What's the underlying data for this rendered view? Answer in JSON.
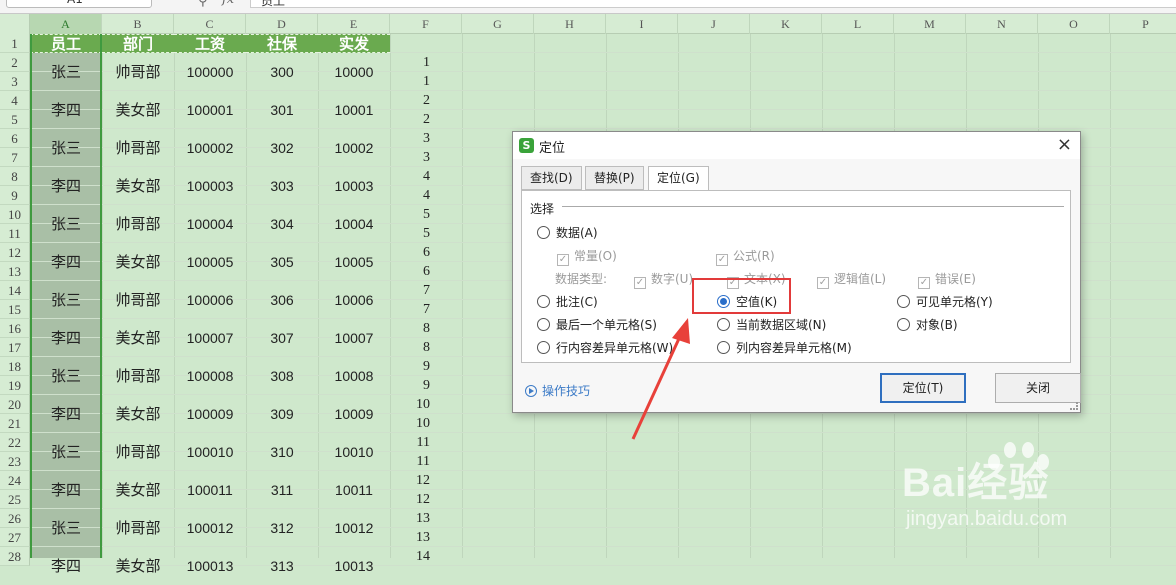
{
  "formula_bar": {
    "cell_ref": "A1",
    "fx_label": "fx",
    "content": "员工"
  },
  "columns": [
    "A",
    "B",
    "C",
    "D",
    "E",
    "F",
    "G",
    "H",
    "I",
    "J",
    "K",
    "L",
    "M",
    "N",
    "O",
    "P"
  ],
  "rows": [
    "1",
    "2",
    "3",
    "4",
    "5",
    "6",
    "7",
    "8",
    "9",
    "10",
    "11",
    "12",
    "13",
    "14",
    "15",
    "16",
    "17",
    "18",
    "19",
    "20",
    "21",
    "22",
    "23",
    "24",
    "25",
    "26",
    "27",
    "28"
  ],
  "table": {
    "headers": [
      "员工",
      "部门",
      "工资",
      "社保",
      "实发"
    ],
    "records": [
      [
        "张三",
        "帅哥部",
        "100000",
        "300",
        "10000"
      ],
      [
        "李四",
        "美女部",
        "100001",
        "301",
        "10001"
      ],
      [
        "张三",
        "帅哥部",
        "100002",
        "302",
        "10002"
      ],
      [
        "李四",
        "美女部",
        "100003",
        "303",
        "10003"
      ],
      [
        "张三",
        "帅哥部",
        "100004",
        "304",
        "10004"
      ],
      [
        "李四",
        "美女部",
        "100005",
        "305",
        "10005"
      ],
      [
        "张三",
        "帅哥部",
        "100006",
        "306",
        "10006"
      ],
      [
        "李四",
        "美女部",
        "100007",
        "307",
        "10007"
      ],
      [
        "张三",
        "帅哥部",
        "100008",
        "308",
        "10008"
      ],
      [
        "李四",
        "美女部",
        "100009",
        "309",
        "10009"
      ],
      [
        "张三",
        "帅哥部",
        "100010",
        "310",
        "10010"
      ],
      [
        "李四",
        "美女部",
        "100011",
        "311",
        "10011"
      ],
      [
        "张三",
        "帅哥部",
        "100012",
        "312",
        "10012"
      ],
      [
        "李四",
        "美女部",
        "100013",
        "313",
        "10013"
      ]
    ],
    "helper_col_f": [
      "",
      "1",
      "1",
      "2",
      "2",
      "3",
      "3",
      "4",
      "4",
      "5",
      "5",
      "6",
      "6",
      "7",
      "7",
      "8",
      "8",
      "9",
      "9",
      "10",
      "10",
      "11",
      "11",
      "12",
      "12",
      "13",
      "13",
      "14"
    ]
  },
  "dialog": {
    "title": "定位",
    "close_icon": "×",
    "tabs": [
      "查找(D)",
      "替换(P)",
      "定位(G)"
    ],
    "active_tab": 2,
    "group_title": "选择",
    "options": {
      "data": "数据(A)",
      "constant": "常量(O)",
      "formula": "公式(R)",
      "data_type_label": "数据类型:",
      "number": "数字(U)",
      "text": "文本(X)",
      "logic": "逻辑值(L)",
      "error": "错误(E)",
      "comment": "批注(C)",
      "blank": "空值(K)",
      "visible": "可见单元格(Y)",
      "last_cell": "最后一个单元格(S)",
      "current_region": "当前数据区域(N)",
      "object": "对象(B)",
      "row_diff": "行内容差异单元格(W)",
      "col_diff": "列内容差异单元格(M)"
    },
    "selected_option": "blank",
    "tips": "操作技巧",
    "locate_button": "定位(T)",
    "close_button": "关闭"
  },
  "watermark": {
    "brand": "Bai经验",
    "site": "jingyan.baidu.com"
  },
  "colors": {
    "header_green": "#6aaa4f",
    "sheet_bg": "#cfe8cc",
    "highlight_red": "#e23a3a",
    "arrow_red": "#e8413a"
  }
}
